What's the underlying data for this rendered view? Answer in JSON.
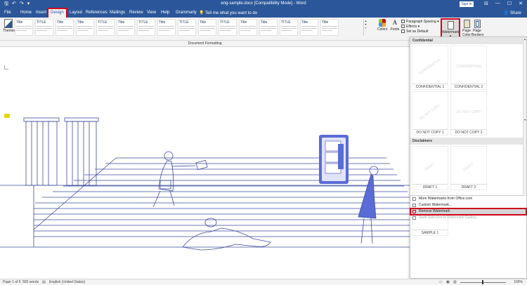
{
  "titlebar": {
    "title": "eng-sample.docx [Compatibility Mode] - Word",
    "signin": "Sign in",
    "qat_icons": [
      "save-icon",
      "undo-icon",
      "redo-icon",
      "customize-icon"
    ],
    "window_buttons": [
      "—",
      "☐",
      "✕"
    ],
    "display_options": "⊟"
  },
  "menu": {
    "tabs": [
      "File",
      "Home",
      "Insert",
      "Design",
      "Layout",
      "References",
      "Mailings",
      "Review",
      "View",
      "Help",
      "Grammarly"
    ],
    "active_tab": "Design",
    "tellme": "Tell me what you want to do",
    "share": "Share"
  },
  "ribbon": {
    "themes_label": "Themes",
    "styles": [
      {
        "heading": "Title"
      },
      {
        "heading": "TITLE"
      },
      {
        "heading": "Title"
      },
      {
        "heading": "Title"
      },
      {
        "heading": "TITLE"
      },
      {
        "heading": "Title"
      },
      {
        "heading": "TITLE"
      },
      {
        "heading": "Title"
      },
      {
        "heading": "TITLE"
      },
      {
        "heading": "Title"
      },
      {
        "heading": "TITLE"
      },
      {
        "heading": "Title"
      },
      {
        "heading": "Title"
      },
      {
        "heading": "TITLE"
      },
      {
        "heading": "Title"
      },
      {
        "heading": "Title"
      }
    ],
    "colors_label": "Colors",
    "fonts_label": "Fonts",
    "paragraph_spacing": "Paragraph Spacing",
    "effects": "Effects",
    "set_default": "Set as Default",
    "watermark_label": "Watermark",
    "page_color_label": "Page Color",
    "page_borders_label": "Page Borders"
  },
  "section_label": "Document Formatting",
  "watermark_menu": {
    "group_confidential": "Confidential",
    "confidential_items": [
      {
        "sample": "CONFIDENTIAL",
        "caption": "CONFIDENTIAL 1"
      },
      {
        "sample": "CONFIDENTIAL",
        "caption": "CONFIDENTIAL 2"
      },
      {
        "sample": "DO NOT COPY",
        "caption": "DO NOT COPY 1"
      },
      {
        "sample": "DO NOT COPY",
        "caption": "DO NOT COPY 2"
      }
    ],
    "group_disclaimers": "Disclaimers",
    "disclaimer_items": [
      {
        "sample": "DRAFT",
        "caption": "DRAFT 1"
      },
      {
        "sample": "DRAFT",
        "caption": "DRAFT 2"
      },
      {
        "sample": "SAMPLE",
        "caption": "SAMPLE 1"
      }
    ],
    "more_watermarks": "More Watermarks from Office.com",
    "custom_watermark": "Custom Watermark...",
    "remove_watermark": "Remove Watermark",
    "save_selection": "Save Selection to Watermark Gallery..."
  },
  "status": {
    "page": "Page 1 of 6",
    "words": "555 words",
    "language": "English (United States)",
    "zoom": "100%"
  },
  "colors": {
    "brand": "#2b579a",
    "highlight": "#d0021b",
    "illustration_fill": "#5b6bd6"
  }
}
